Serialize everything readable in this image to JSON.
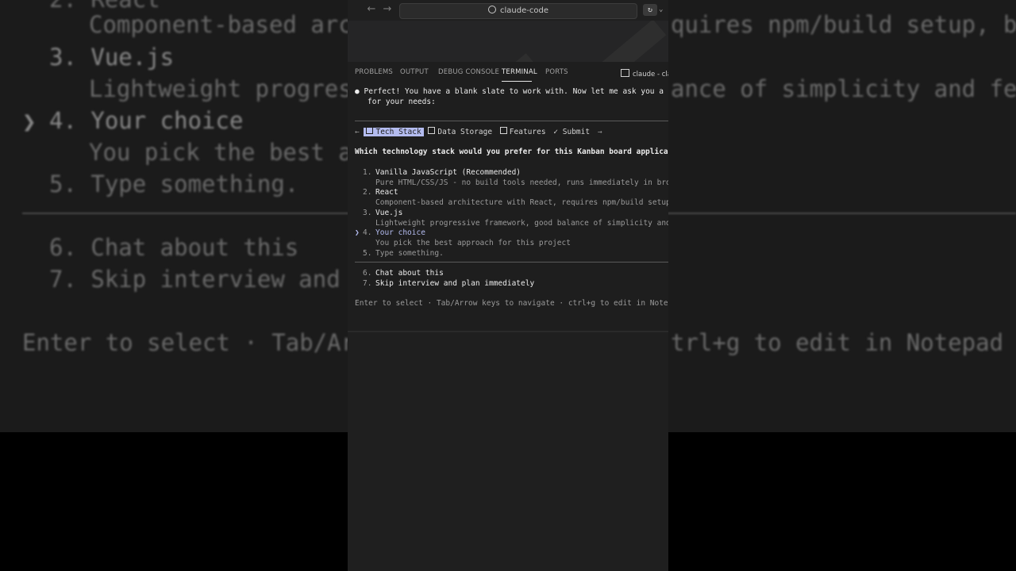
{
  "background": {
    "lines": [
      "2. React",
      "Component-based arch",
      "quires npm/build setup, bet",
      "3. Vue.js",
      "Lightweight progress",
      "ance of simplicity and feat",
      "4. Your choice",
      "You pick the best ap",
      "5. Type something.",
      "6. Chat about this",
      "7. Skip interview and p",
      "Enter to select · Tab/Arr",
      "trl+g to edit in Notepad ·"
    ]
  },
  "titlebar": {
    "back_icon": "←",
    "forward_icon": "→",
    "search_text": "claude-code",
    "copilot_icon": "↻",
    "dropdown_icon": "⌄"
  },
  "panel_tabs": {
    "problems": "PROBLEMS",
    "output": "OUTPUT",
    "debug_console": "DEBUG CONSOLE",
    "terminal": "TERMINAL",
    "ports": "PORTS",
    "terminal_instance": "claude - clau"
  },
  "terminal": {
    "bullet": "●",
    "intro_line1": "Perfect! You have a blank slate to work with. Now let me ask you a few qu",
    "intro_line2": "for your needs:",
    "nav_left": "←",
    "nav_right": "→",
    "tabs": {
      "tech_stack": "Tech Stack",
      "data_storage": "Data Storage",
      "features": "Features",
      "submit_check": "✓",
      "submit": "Submit"
    },
    "question": "Which technology stack would you prefer for this Kanban board application?",
    "options": [
      {
        "num": "1.",
        "label": "Vanilla JavaScript (Recommended)",
        "desc": "Pure HTML/CSS/JS - no build tools needed, runs immediately in browser,"
      },
      {
        "num": "2.",
        "label": "React",
        "desc": "Component-based architecture with React, requires npm/build setup, bet"
      },
      {
        "num": "3.",
        "label": "Vue.js",
        "desc": "Lightweight progressive framework, good balance of simplicity and feat"
      },
      {
        "num": "4.",
        "label": "Your choice",
        "desc": "You pick the best approach for this project"
      },
      {
        "num": "5.",
        "label": "Type something.",
        "desc": ""
      }
    ],
    "pointer": "❯",
    "extra_options": [
      {
        "num": "6.",
        "label": "Chat about this"
      },
      {
        "num": "7.",
        "label": "Skip interview and plan immediately"
      }
    ],
    "footer": "Enter to select · Tab/Arrow keys to navigate · ctrl+g to edit in Notepad ·"
  }
}
